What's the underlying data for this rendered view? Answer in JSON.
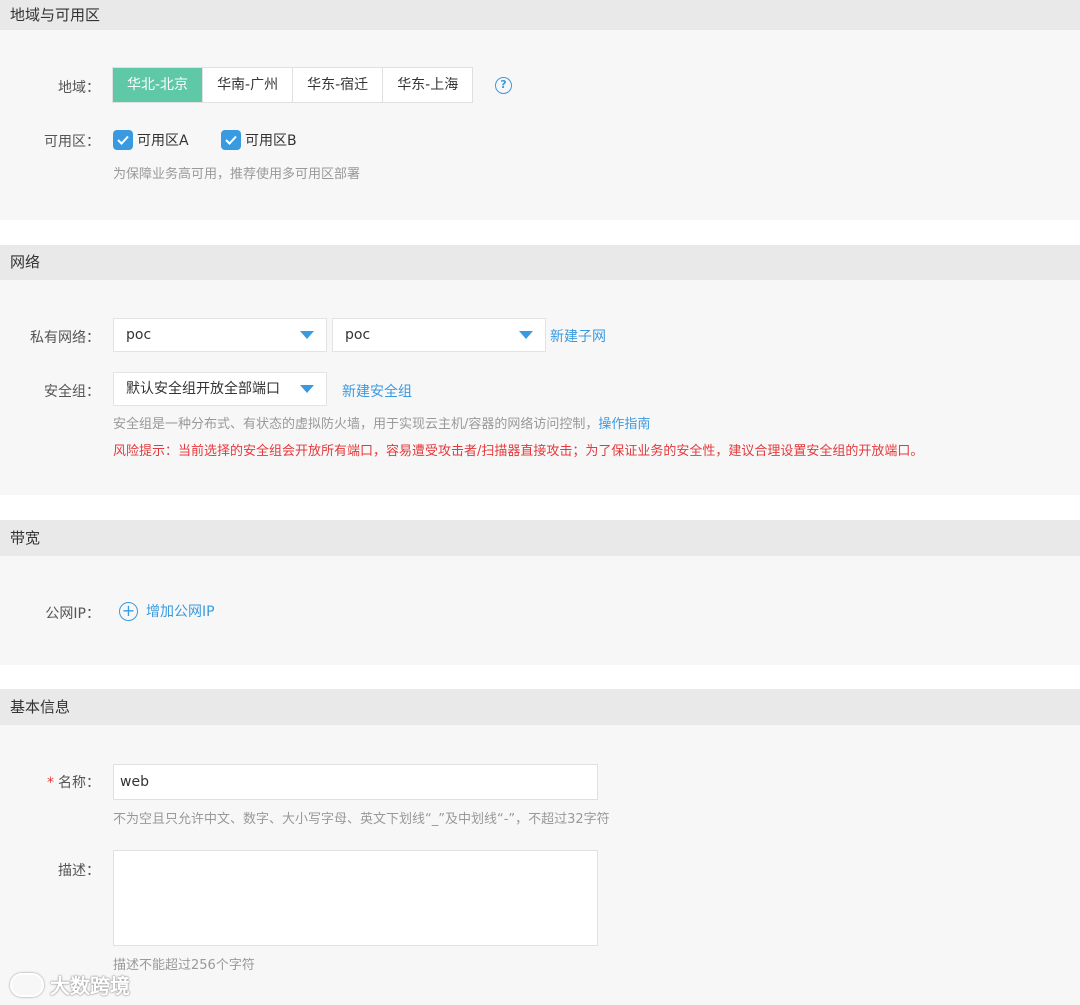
{
  "region_section": {
    "title": "地域与可用区",
    "region_label": "地域：",
    "regions": [
      "华北-北京",
      "华南-广州",
      "华东-宿迁",
      "华东-上海"
    ],
    "selected_region": "华北-北京",
    "az_label": "可用区：",
    "zones": [
      {
        "label": "可用区A",
        "checked": true
      },
      {
        "label": "可用区B",
        "checked": true
      }
    ],
    "az_hint": "为保障业务高可用，推荐使用多可用区部署"
  },
  "network_section": {
    "title": "网络",
    "vpc_label": "私有网络：",
    "vpc_value": "poc",
    "subnet_value": "poc",
    "new_subnet_link": "新建子网",
    "sg_label": "安全组：",
    "sg_value": "默认安全组开放全部端口",
    "new_sg_link": "新建安全组",
    "sg_hint": "安全组是一种分布式、有状态的虚拟防火墙，用于实现云主机/容器的网络访问控制，",
    "sg_guide_link": "操作指南",
    "risk_warning": "风险提示：当前选择的安全组会开放所有端口，容易遭受攻击者/扫描器直接攻击；为了保证业务的安全性，建议合理设置安全组的开放端口。"
  },
  "bandwidth_section": {
    "title": "带宽",
    "public_ip_label": "公网IP：",
    "add_ip_link": "增加公网IP"
  },
  "basic_section": {
    "title": "基本信息",
    "name_required_mark": "*",
    "name_label": "名称：",
    "name_value": "web",
    "name_hint": "不为空且只允许中文、数字、大小写字母、英文下划线“_”及中划线“-”，不超过32字符",
    "desc_label": "描述：",
    "desc_value": "",
    "desc_hint": "描述不能超过256个字符"
  },
  "watermark": {
    "text": "大数跨境"
  },
  "colors": {
    "accent": "#3a9ae0",
    "selected_region_bg": "#5ec8a7",
    "warning": "#e4393c",
    "section_header_bg": "#e9e9e9",
    "section_body_bg": "#f7f7f7"
  }
}
